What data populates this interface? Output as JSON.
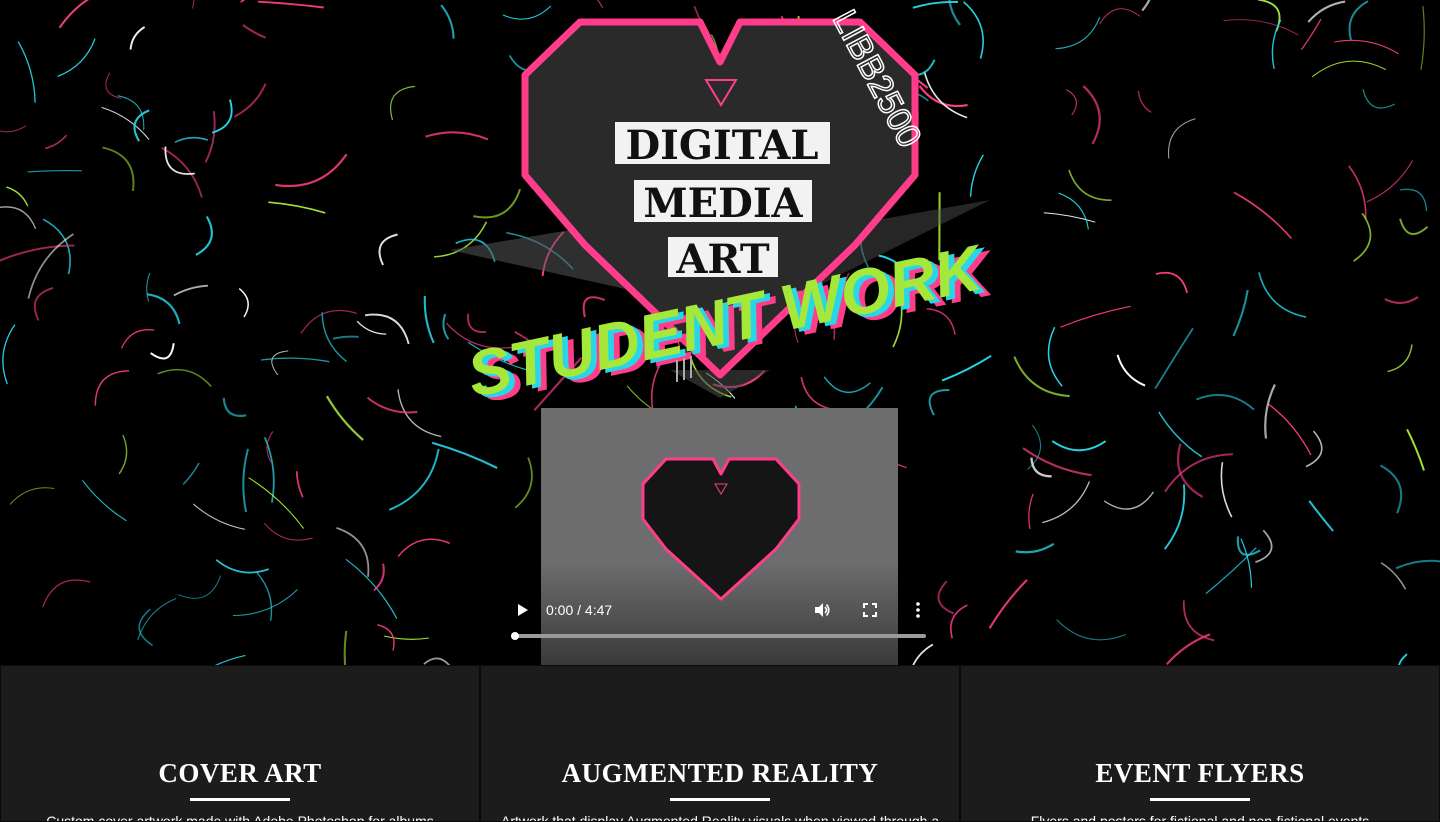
{
  "hero": {
    "logo": {
      "line1": "DIGITAL",
      "line2": "MEDIA",
      "line3": "ART",
      "banner": "STUDENT WORK",
      "course_code": "LIBB2500"
    },
    "colors": {
      "pink": "#ff3d8b",
      "cyan": "#27d7e8",
      "lime": "#a6e83a",
      "dark": "#2a2a2a"
    }
  },
  "video": {
    "current_time": "0:00",
    "separator": "/",
    "duration": "4:47",
    "time_display": "0:00 / 4:47",
    "progress": 0,
    "icons": {
      "play": "play-icon",
      "volume": "volume-icon",
      "fullscreen": "fullscreen-icon",
      "more": "more-vertical-icon"
    }
  },
  "cards": [
    {
      "title": "COVER ART",
      "description": "Custom cover artwork made with Adobe Photoshop for albums"
    },
    {
      "title": "AUGMENTED REALITY",
      "description": "Artwork that display Augmented Reality visuals when viewed through a"
    },
    {
      "title": "EVENT FLYERS",
      "description": "Flyers and posters for fictional and non-fictional events"
    }
  ]
}
